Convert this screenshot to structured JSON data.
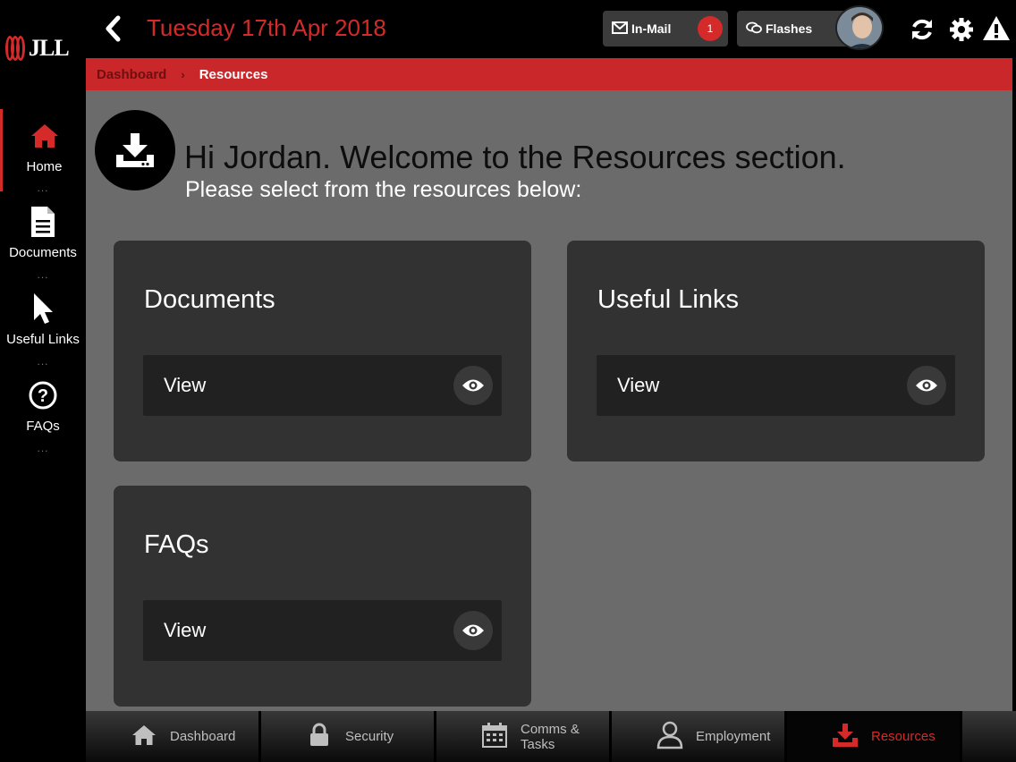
{
  "app": {
    "logo_text": "JLL"
  },
  "topbar": {
    "date": "Tuesday 17th Apr 2018",
    "inmail_label": "In-Mail",
    "inmail_count": "1",
    "flashes_label": "Flashes"
  },
  "sidebar": {
    "items": [
      {
        "label": "Home",
        "icon": "home-icon"
      },
      {
        "label": "Documents",
        "icon": "document-icon"
      },
      {
        "label": "Useful Links",
        "icon": "cursor-icon"
      },
      {
        "label": "FAQs",
        "icon": "question-circle-icon"
      }
    ],
    "dots": "..."
  },
  "breadcrumb": {
    "parent": "Dashboard",
    "separator": "›",
    "current": "Resources"
  },
  "main": {
    "welcome": "Hi Jordan. Welcome to the Resources section.",
    "instructions": "Please select from the resources below:",
    "cards": [
      {
        "title": "Documents",
        "button": "View"
      },
      {
        "title": "Useful Links",
        "button": "View"
      },
      {
        "title": "FAQs",
        "button": "View"
      }
    ]
  },
  "bottomnav": {
    "tabs": [
      {
        "label": "Dashboard",
        "icon": "home-icon"
      },
      {
        "label": "Security",
        "icon": "lock-icon"
      },
      {
        "label": "Comms & Tasks",
        "icon": "calendar-icon"
      },
      {
        "label": "Employment",
        "icon": "user-icon"
      },
      {
        "label": "Resources",
        "icon": "download-icon",
        "active": true
      }
    ]
  },
  "colors": {
    "accent": "#d42a2a",
    "panel": "#333233",
    "background": "#6b6b6c"
  }
}
